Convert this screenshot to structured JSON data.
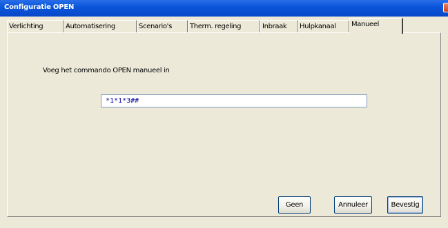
{
  "window": {
    "title": "Configuratie OPEN"
  },
  "tabs": [
    {
      "label": "Verlichting",
      "active": false
    },
    {
      "label": "Automatisering",
      "active": false
    },
    {
      "label": "Scenario's",
      "active": false
    },
    {
      "label": "Therm. regeling",
      "active": false
    },
    {
      "label": "Inbraak",
      "active": false
    },
    {
      "label": "Hulpkanaal",
      "active": false
    },
    {
      "label": "Manueel",
      "active": true
    }
  ],
  "main": {
    "prompt": "Voeg het commando OPEN manueel in",
    "command_value": "*1*1*3##"
  },
  "buttons": {
    "geen": "Geen",
    "annuleer": "Annuleer",
    "bevestig": "Bevestig"
  },
  "colors": {
    "titlebar": "#0a56dc",
    "window_bg": "#ece9d8",
    "input_text": "#0a0aa0"
  }
}
